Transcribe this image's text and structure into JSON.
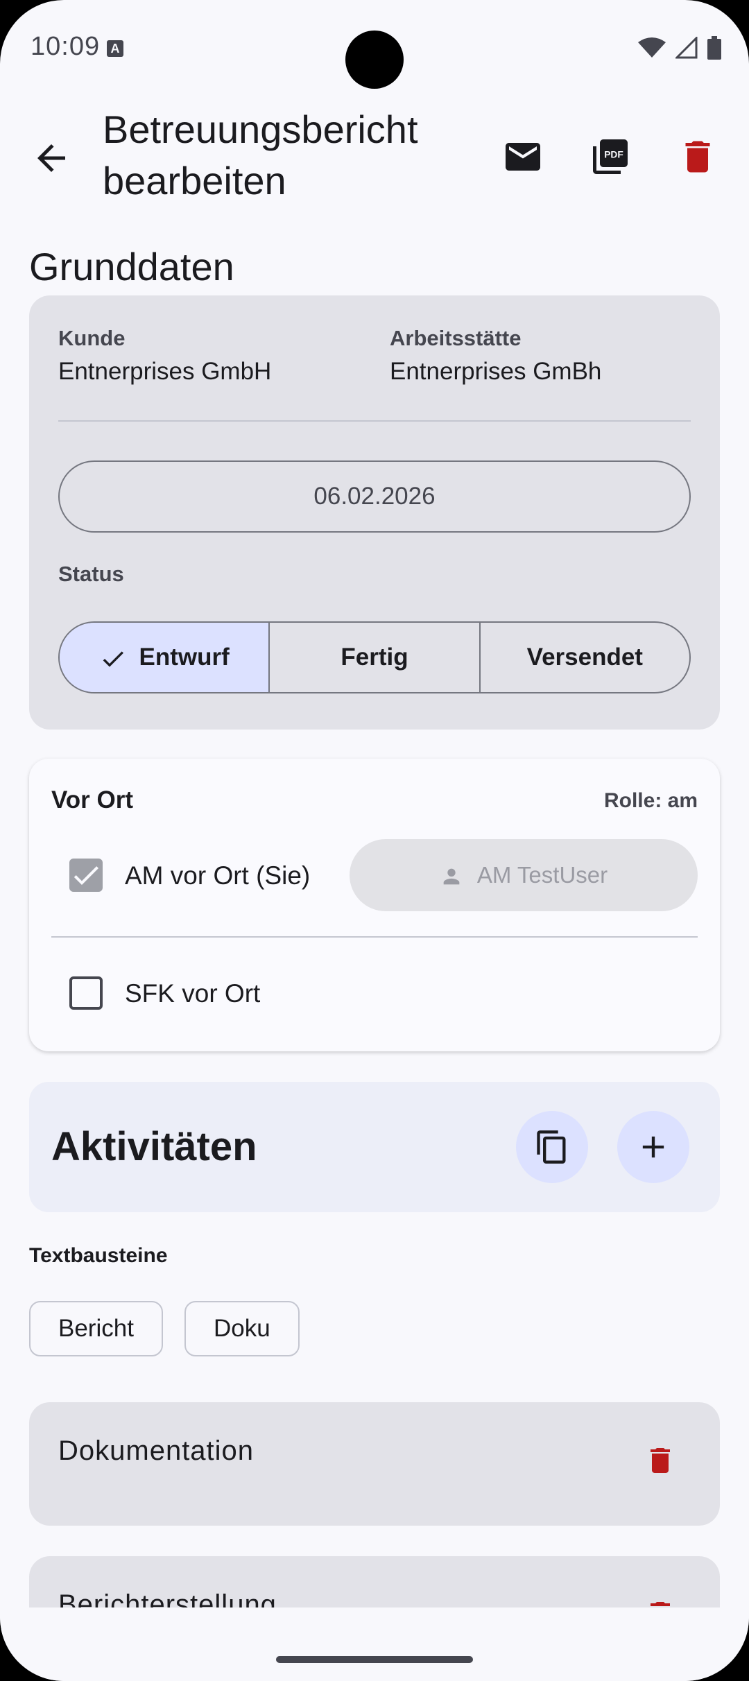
{
  "status_bar": {
    "time": "10:09",
    "notif_letter": "A"
  },
  "app_bar": {
    "title_line1": "Betreuungsbericht",
    "title_line2": "bearbeiten",
    "icons": [
      "back-arrow-icon",
      "mail-icon",
      "pdf-icon",
      "delete-icon"
    ],
    "delete_color": "#ba1a1a"
  },
  "grunddaten": {
    "section_title": "Grunddaten",
    "kunde_label": "Kunde",
    "kunde_value": "Entnerprises GmbH",
    "arbeitsstaette_label": "Arbeitsstätte",
    "arbeitsstaette_value": "Entnerprises GmBh",
    "date": "06.02.2026",
    "status_label": "Status",
    "status_options": [
      "Entwurf",
      "Fertig",
      "Versendet"
    ],
    "status_selected": "Entwurf"
  },
  "vor_ort": {
    "title": "Vor Ort",
    "role": "Rolle: am",
    "am_label": "AM vor Ort (Sie)",
    "am_checked": true,
    "am_user": "AM TestUser",
    "sfk_label": "SFK vor Ort",
    "sfk_checked": false
  },
  "aktivitaeten": {
    "title": "Aktivitäten",
    "icons": [
      "copy-icon",
      "add-icon"
    ]
  },
  "textbausteine": {
    "label": "Textbausteine",
    "chips": [
      "Bericht",
      "Doku"
    ]
  },
  "list": [
    {
      "title": "Dokumentation"
    },
    {
      "title": "Berichterstellung"
    }
  ],
  "colors": {
    "accent_container": "#dce1ff",
    "card_bg": "#e2e2e8",
    "danger": "#ba1a1a"
  }
}
